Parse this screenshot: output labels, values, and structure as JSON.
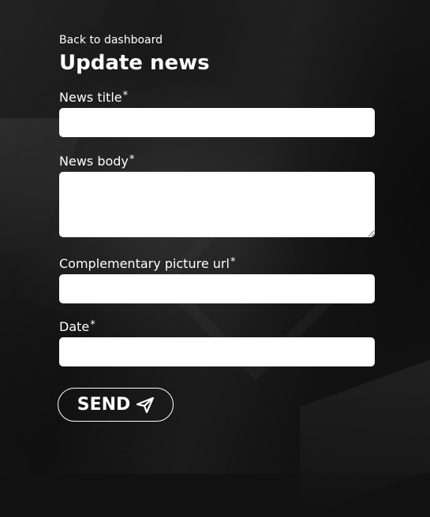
{
  "back_link": "Back to dashboard",
  "title": "Update news",
  "fields": [
    {
      "label": "News title",
      "required_mark": "*",
      "value": ""
    },
    {
      "label": "News body",
      "required_mark": "*",
      "value": ""
    },
    {
      "label": "Complementary picture url",
      "required_mark": "*",
      "value": ""
    },
    {
      "label": "Date",
      "required_mark": "*",
      "value": ""
    }
  ],
  "send_button": {
    "label": "SEND",
    "icon": "send-icon"
  }
}
